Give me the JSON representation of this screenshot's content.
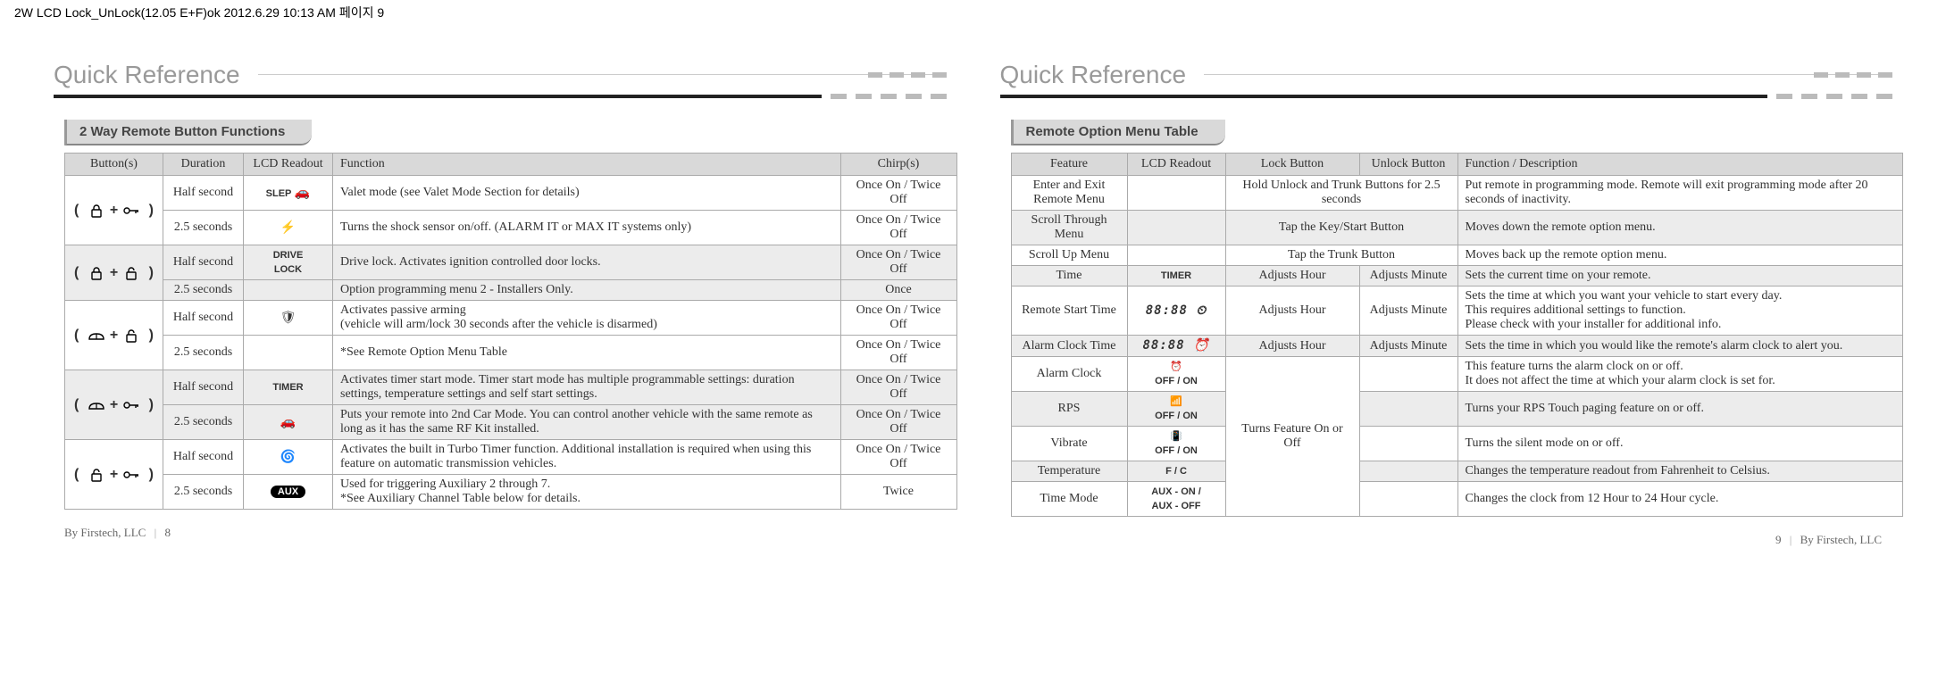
{
  "annotation": "2W LCD Lock_UnLock(12.05 E+F)ok  2012.6.29 10:13 AM  페이지 9",
  "left": {
    "title": "Quick Reference",
    "section": "2 Way Remote Button Functions",
    "headers": [
      "Button(s)",
      "Duration",
      "LCD Readout",
      "Function",
      "Chirp(s)"
    ],
    "groups": [
      {
        "button_icons": [
          "lock",
          "key"
        ],
        "rows": [
          {
            "shade": false,
            "duration": "Half second",
            "lcd_text": "SLEP",
            "lcd_icon": "sleep-car",
            "function": "Valet mode (see Valet Mode Section for details)",
            "chirp": "Once On / Twice Off"
          },
          {
            "shade": false,
            "duration": "2.5 seconds",
            "lcd_text": "",
            "lcd_icon": "shock",
            "function": "Turns the shock sensor on/off. (ALARM IT or MAX IT systems only)",
            "chirp": "Once On / Twice Off"
          }
        ]
      },
      {
        "button_icons": [
          "lock",
          "unlock"
        ],
        "rows": [
          {
            "shade": true,
            "duration": "Half second",
            "lcd_text": "DRIVE\nLOCK",
            "lcd_icon": "",
            "function": "Drive lock. Activates ignition controlled door locks.",
            "chirp": "Once On / Twice Off"
          },
          {
            "shade": true,
            "duration": "2.5 seconds",
            "lcd_text": "",
            "lcd_icon": "",
            "function": "Option programming menu 2 - Installers Only.",
            "chirp": "Once"
          }
        ]
      },
      {
        "button_icons": [
          "trunk",
          "unlock"
        ],
        "rows": [
          {
            "shade": false,
            "duration": "Half second",
            "lcd_text": "",
            "lcd_icon": "passive",
            "function": "Activates passive arming\n(vehicle will arm/lock 30 seconds after the vehicle is disarmed)",
            "chirp": "Once On / Twice Off"
          },
          {
            "shade": false,
            "duration": "2.5 seconds",
            "lcd_text": "",
            "lcd_icon": "",
            "function": "*See Remote Option Menu Table",
            "chirp": "Once On / Twice Off"
          }
        ]
      },
      {
        "button_icons": [
          "trunk",
          "key"
        ],
        "rows": [
          {
            "shade": true,
            "duration": "Half second",
            "lcd_text": "TIMER",
            "lcd_icon": "",
            "function": "Activates timer start mode. Timer start mode has multiple programmable settings:  duration settings, temperature settings and self start settings.",
            "chirp": "Once On / Twice Off"
          },
          {
            "shade": true,
            "duration": "2.5 seconds",
            "lcd_text": "",
            "lcd_icon": "2nd-car",
            "function": "Puts your remote into 2nd Car Mode. You can control another vehicle with the same remote as long as it has the same RF Kit installed.",
            "chirp": "Once On / Twice Off"
          }
        ]
      },
      {
        "button_icons": [
          "unlock",
          "key"
        ],
        "rows": [
          {
            "shade": false,
            "duration": "Half second",
            "lcd_text": "",
            "lcd_icon": "turbo",
            "function": "Activates the built in Turbo Timer function. Additional installation is required when using this feature on automatic transmission vehicles.",
            "chirp": "Once On / Twice Off"
          },
          {
            "shade": false,
            "duration": "2.5 seconds",
            "lcd_text": "AUX",
            "lcd_icon": "aux",
            "function": "Used for triggering Auxiliary 2 through 7.\n*See Auxiliary Channel Table below for details.",
            "chirp": "Twice"
          }
        ]
      }
    ],
    "footer_company": "By Firstech, LLC",
    "footer_page": "8"
  },
  "right": {
    "title": "Quick Reference",
    "section": "Remote Option Menu Table",
    "headers": [
      "Feature",
      "LCD Readout",
      "Lock Button",
      "Unlock Button",
      "Function / Description"
    ],
    "rows": [
      {
        "shade": false,
        "feature": "Enter and Exit Remote Menu",
        "lcd": "",
        "lock_unlock_merged": "Hold Unlock and Trunk Buttons for 2.5 seconds",
        "desc": "Put remote in programming mode. Remote will exit programming mode after 20 seconds of inactivity."
      },
      {
        "shade": true,
        "feature": "Scroll Through Menu",
        "lcd": "",
        "lock_unlock_merged": "Tap the Key/Start Button",
        "desc": "Moves down the remote option menu."
      },
      {
        "shade": false,
        "feature": "Scroll Up Menu",
        "lcd": "",
        "lock_unlock_merged": "Tap the Trunk Button",
        "desc": "Moves back up the remote option menu."
      },
      {
        "shade": true,
        "feature": "Time",
        "lcd": "TIMER",
        "lock": "Adjusts Hour",
        "unlock": "Adjusts Minute",
        "desc": "Sets the current time on your remote."
      },
      {
        "shade": false,
        "feature": "Remote Start Time",
        "lcd": "88:88 ⏲",
        "lock": "Adjusts Hour",
        "unlock": "Adjusts Minute",
        "desc": "Sets the time at which you want your vehicle to start every day.\nThis requires additional settings to function.\nPlease check with your installer for additional info."
      },
      {
        "shade": true,
        "feature": "Alarm Clock Time",
        "lcd": "88:88  ⏰",
        "lock": "Adjusts Hour",
        "unlock": "Adjusts Minute",
        "desc": "Sets the time in which you would like the remote's alarm clock to alert you."
      },
      {
        "shade": false,
        "feature": "Alarm Clock",
        "lcd": "⏰\nOFF / ON",
        "lock_merged_span": 5,
        "lock_merged_text": "Turns Feature On or Off",
        "unlock": "",
        "desc": "This feature turns the alarm clock on or off.\nIt does not affect the time at which your alarm clock is set for."
      },
      {
        "shade": true,
        "feature": "RPS",
        "lcd": "📶\nOFF / ON",
        "unlock": "",
        "desc": "Turns your RPS Touch paging feature on or off."
      },
      {
        "shade": false,
        "feature": "Vibrate",
        "lcd": "📳\nOFF / ON",
        "unlock": "",
        "desc": "Turns the silent mode on or off."
      },
      {
        "shade": true,
        "feature": "Temperature",
        "lcd": "F /  C",
        "unlock": "",
        "desc": "Changes the temperature readout from Fahrenheit to Celsius."
      },
      {
        "shade": false,
        "feature": "Time Mode",
        "lcd": "AUX -  ON /\nAUX -  OFF",
        "unlock": "",
        "desc": "Changes the clock from 12 Hour to 24 Hour cycle."
      }
    ],
    "footer_company": "By Firstech, LLC",
    "footer_page": "9"
  }
}
